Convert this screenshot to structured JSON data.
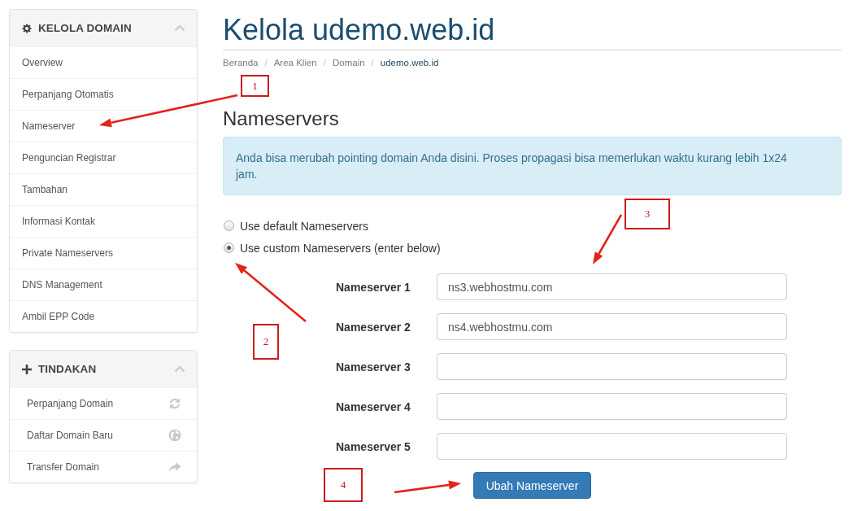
{
  "sidebar": {
    "panels": [
      {
        "kind": "menu",
        "title": "KELOLA DOMAIN",
        "expanded": true,
        "items": [
          {
            "label": "Overview",
            "selected": false
          },
          {
            "label": "Perpanjang Otomatis",
            "selected": false
          },
          {
            "label": "Nameserver",
            "selected": false
          },
          {
            "label": "Penguncian Registrar",
            "selected": false
          },
          {
            "label": "Tambahan",
            "selected": false
          },
          {
            "label": "Informasi Kontak",
            "selected": false
          },
          {
            "label": "Private Nameservers",
            "selected": false
          },
          {
            "label": "DNS Management",
            "selected": false
          },
          {
            "label": "Ambil EPP Code",
            "selected": false
          }
        ]
      },
      {
        "kind": "actions",
        "title": "TINDAKAN",
        "expanded": true,
        "items": [
          {
            "label": "Perpanjang Domain"
          },
          {
            "label": "Daftar Domain Baru"
          },
          {
            "label": "Transfer Domain"
          }
        ]
      }
    ]
  },
  "page": {
    "title": "Kelola udemo.web.id"
  },
  "breadcrumb": {
    "items": [
      {
        "label": "Beranda",
        "active": false,
        "separator": "/"
      },
      {
        "label": "Area Klien",
        "active": false,
        "separator": "/"
      },
      {
        "label": "Domain",
        "active": false,
        "separator": "/"
      },
      {
        "label": "udemo.web.id",
        "active": true
      }
    ]
  },
  "section": {
    "heading": "Nameservers",
    "alert": "Anda bisa merubah pointing domain Anda disini. Proses propagasi bisa memerlukan waktu kurang lebih 1x24 jam.",
    "radios": [
      {
        "label": "Use default Nameservers",
        "selected": false
      },
      {
        "label": "Use custom Nameservers (enter below)",
        "selected": true
      }
    ],
    "nameservers": [
      {
        "label": "Nameserver 1",
        "value": "ns3.webhostmu.com"
      },
      {
        "label": "Nameserver 2",
        "value": "ns4.webhostmu.com"
      },
      {
        "label": "Nameserver 3"
      },
      {
        "label": "Nameserver 4"
      },
      {
        "label": "Nameserver 5"
      }
    ],
    "button": "Ubah Nameserver"
  },
  "annotations": [
    {
      "number": "1"
    },
    {
      "number": "2"
    },
    {
      "number": "3"
    },
    {
      "number": "4"
    }
  ]
}
